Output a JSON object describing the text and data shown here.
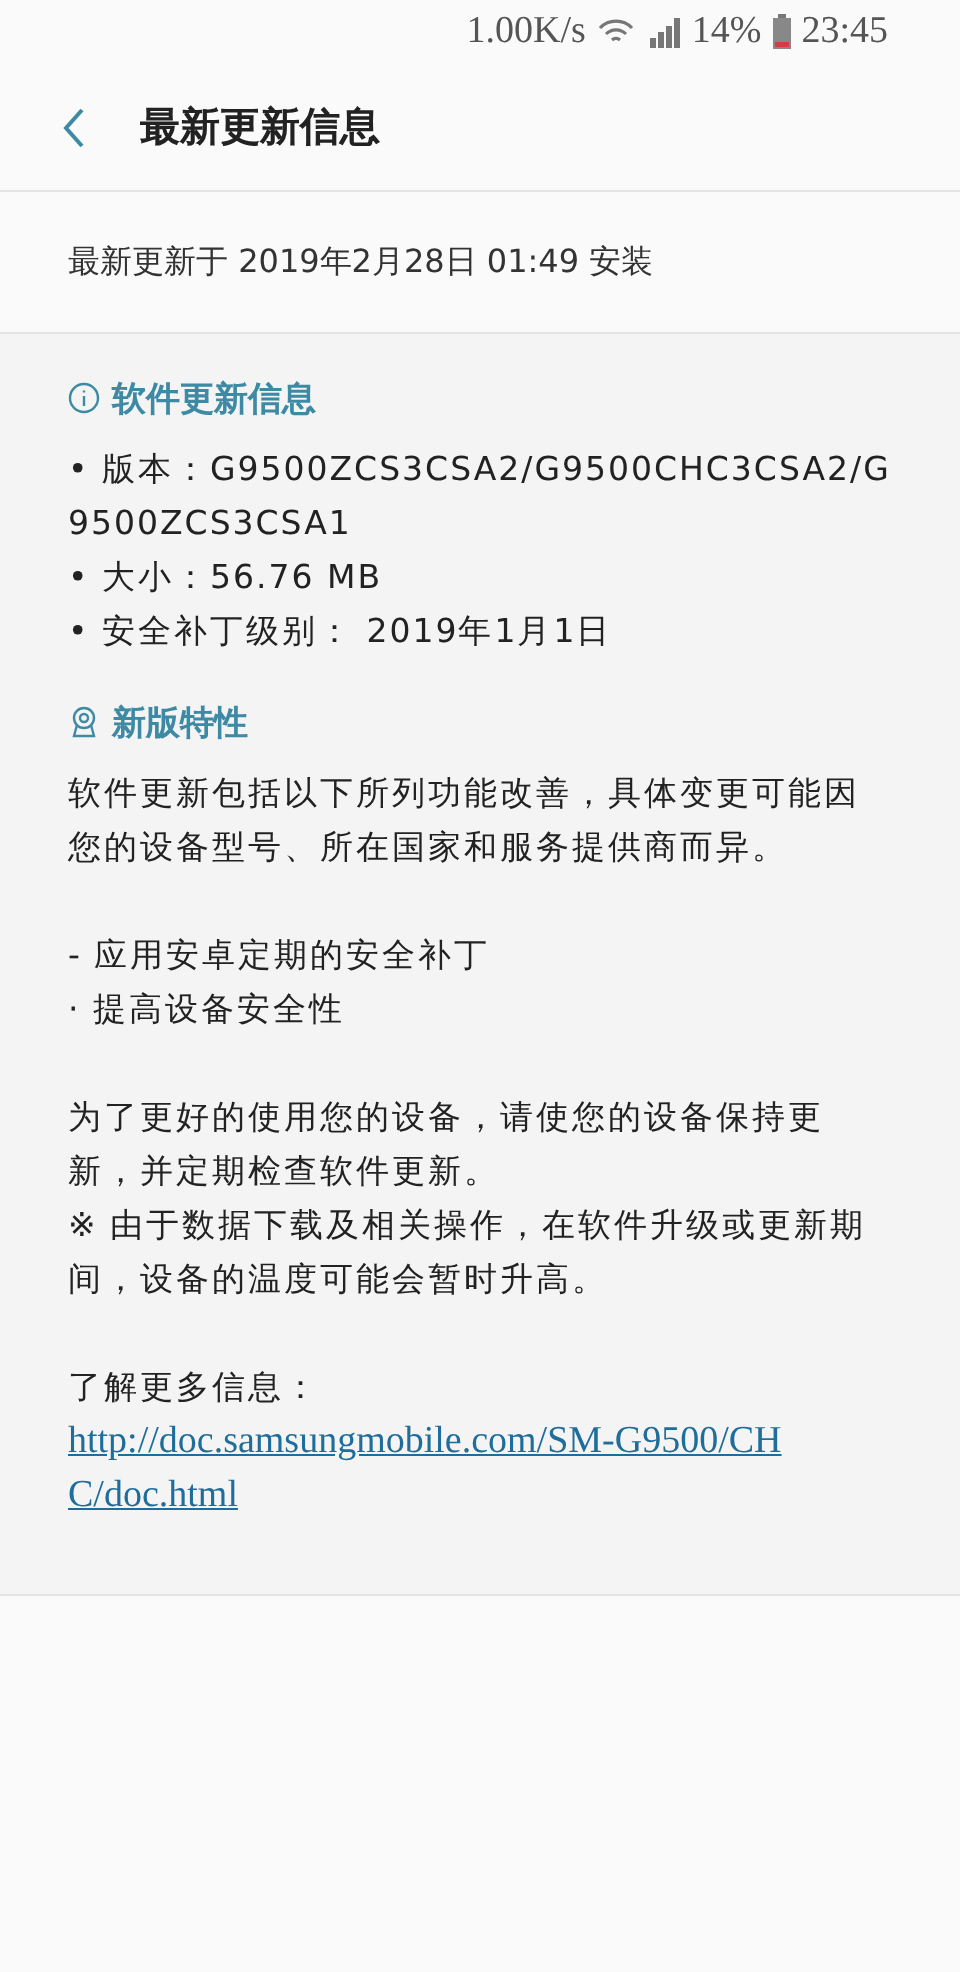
{
  "status_bar": {
    "speed": "1.00K/s",
    "battery": "14%",
    "time": "23:45"
  },
  "header": {
    "title": "最新更新信息"
  },
  "install_info": "最新更新于 2019年2月28日 01:49 安装",
  "sections": [
    {
      "kind": "info",
      "title": "软件更新信息",
      "blocks": [
        [
          {
            "kind": "text",
            "text": "• 版本：G9500ZCS3CSA2/G9500CHC3CSA2/G9500ZCS3CSA1"
          },
          {
            "kind": "text",
            "text": "• 大小：56.76 MB"
          },
          {
            "kind": "text",
            "text": "• 安全补丁级别： 2019年1月1日"
          }
        ]
      ]
    },
    {
      "kind": "features",
      "title": "新版特性",
      "blocks": [
        [
          {
            "kind": "text",
            "text": "软件更新包括以下所列功能改善，具体变更可能因您的设备型号、所在国家和服务提供商而异。"
          }
        ],
        [
          {
            "kind": "text",
            "text": "- 应用安卓定期的安全补丁"
          },
          {
            "kind": "text",
            "text": "· 提高设备安全性"
          }
        ],
        [
          {
            "kind": "text",
            "text": "为了更好的使用您的设备，请使您的设备保持更新，并定期检查软件更新。"
          },
          {
            "kind": "text",
            "text": "※ 由于数据下载及相关操作，在软件升级或更新期间，设备的温度可能会暂时升高。"
          }
        ],
        [
          {
            "kind": "text",
            "text": "了解更多信息："
          },
          {
            "kind": "link",
            "text": "http://doc.samsungmobile.com/SM-G9500/CHC/doc.html"
          }
        ]
      ]
    }
  ]
}
